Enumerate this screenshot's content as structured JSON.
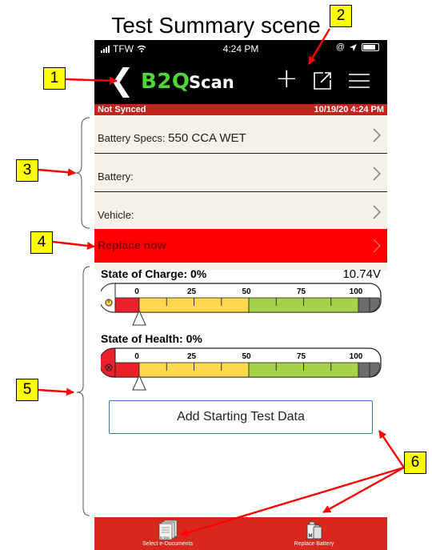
{
  "scene_title": "Test Summary scene",
  "status_bar": {
    "carrier": "TFW",
    "time": "4:24 PM"
  },
  "nav": {
    "back_icon": "chevron-left-icon",
    "logo": "B2QScan",
    "add_icon": "plus-icon",
    "export_icon": "export-icon",
    "menu_icon": "hamburger-menu-icon"
  },
  "sync": {
    "status": "Not Synced",
    "timestamp": "10/19/20 4:24 PM"
  },
  "info_rows": [
    {
      "label": "Battery Specs:",
      "value": "550 CCA WET"
    },
    {
      "label": "Battery:",
      "value": ""
    },
    {
      "label": "Vehicle:",
      "value": ""
    }
  ],
  "result": {
    "label": "Replace now"
  },
  "state_of_charge": {
    "label": "State of Charge: 0%",
    "voltage": "10.74V",
    "percent": 0,
    "ticks": [
      "0",
      "25",
      "50",
      "75",
      "100"
    ]
  },
  "state_of_health": {
    "label": "State of Health: 0%",
    "percent": 0,
    "ticks": [
      "0",
      "25",
      "50",
      "75",
      "100"
    ]
  },
  "add_button": {
    "label": "Add Starting Test Data"
  },
  "tabs": [
    {
      "label": "Select e-Documents",
      "icon": "documents-icon",
      "badge": "E-Doc"
    },
    {
      "label": "Replace Battery",
      "icon": "replace-battery-icon"
    }
  ],
  "callouts": [
    "1",
    "2",
    "3",
    "4",
    "5",
    "6"
  ],
  "colors": {
    "nav_bg": "#000000",
    "sync_bar": "#c0241c",
    "info_bg": "#f4f1e6",
    "replace_bar": "#ff0000",
    "tab_bar": "#d8281e",
    "gauge_red": "#e8212a",
    "gauge_yellow": "#ffd84d",
    "gauge_green": "#a6d14a",
    "gauge_gray": "#6d6d6d",
    "callout": "#ffff00",
    "arrow": "#ff0000"
  }
}
